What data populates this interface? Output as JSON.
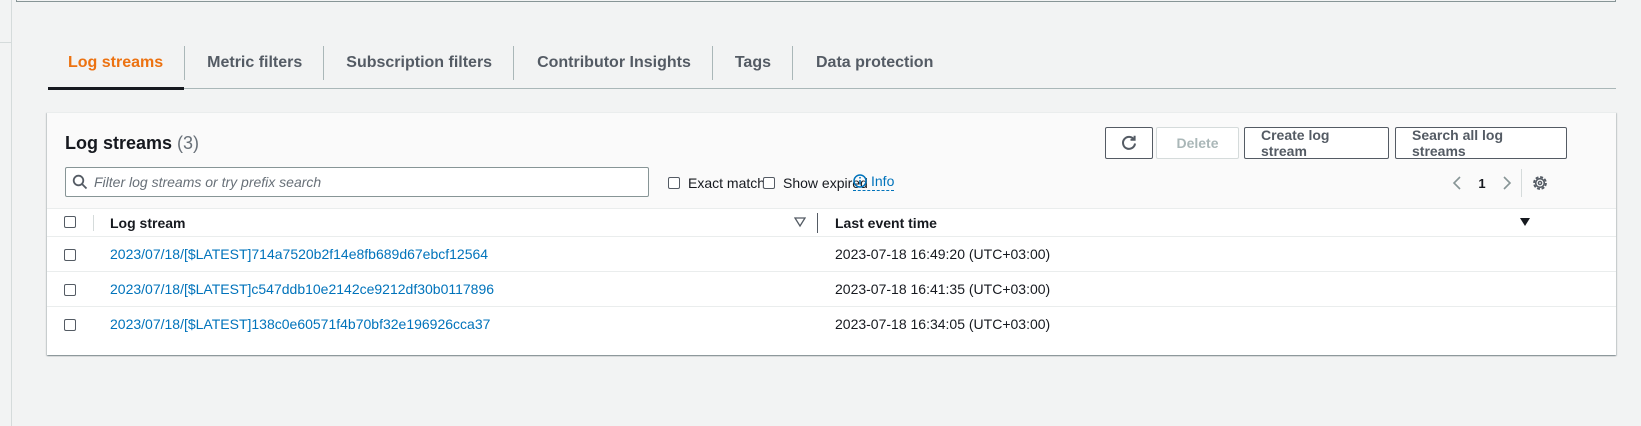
{
  "tabs": [
    {
      "label": "Log streams",
      "active": true
    },
    {
      "label": "Metric filters",
      "active": false
    },
    {
      "label": "Subscription filters",
      "active": false
    },
    {
      "label": "Contributor Insights",
      "active": false
    },
    {
      "label": "Tags",
      "active": false
    },
    {
      "label": "Data protection",
      "active": false
    }
  ],
  "panel": {
    "title": "Log streams",
    "count": "(3)",
    "refresh_icon": "refresh-icon",
    "delete_label": "Delete",
    "create_label": "Create log stream",
    "search_all_label": "Search all log streams",
    "search_placeholder": "Filter log streams or try prefix search",
    "search_value": "",
    "exact_match_label": "Exact match",
    "show_expired_label": "Show expired",
    "info_label": "Info",
    "page_number": "1"
  },
  "table": {
    "columns": [
      "Log stream",
      "Last event time"
    ],
    "rows": [
      {
        "stream": "2023/07/18/[$LATEST]714a7520b2f14e8fb689d67ebcf12564",
        "time": "2023-07-18 16:49:20 (UTC+03:00)"
      },
      {
        "stream": "2023/07/18/[$LATEST]c547ddb10e2142ce9212df30b0117896",
        "time": "2023-07-18 16:41:35 (UTC+03:00)"
      },
      {
        "stream": "2023/07/18/[$LATEST]138c0e60571f4b70bf32e196926cca37",
        "time": "2023-07-18 16:34:05 (UTC+03:00)"
      }
    ]
  },
  "colors": {
    "active_tab": "#ec7211",
    "link": "#0073bb",
    "text": "#16191f",
    "muted": "#545b64"
  }
}
